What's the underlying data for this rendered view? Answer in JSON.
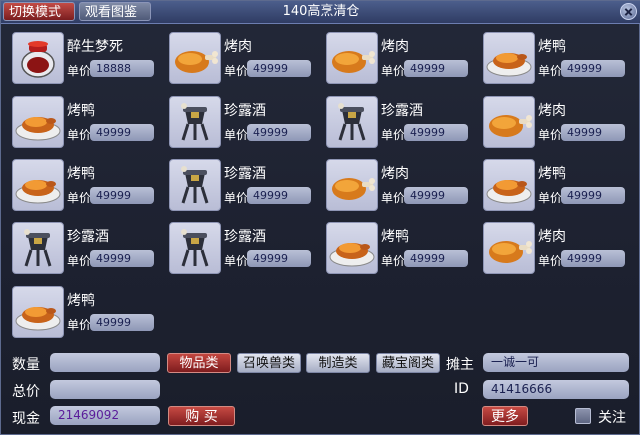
{
  "titlebar": {
    "switch_mode_label": "切换模式",
    "view_catalog_label": "观看图鉴",
    "title": "140高烹清仓"
  },
  "items": [
    {
      "name": "醉生梦死",
      "price_label": "单价",
      "price": "18888",
      "icon": "wine-jar-icon"
    },
    {
      "name": "烤肉",
      "price_label": "单价",
      "price": "49999",
      "icon": "roast-meat-icon"
    },
    {
      "name": "烤肉",
      "price_label": "单价",
      "price": "49999",
      "icon": "roast-meat-icon"
    },
    {
      "name": "烤鸭",
      "price_label": "单价",
      "price": "49999",
      "icon": "roast-duck-icon"
    },
    {
      "name": "烤鸭",
      "price_label": "单价",
      "price": "49999",
      "icon": "roast-duck-icon"
    },
    {
      "name": "珍露酒",
      "price_label": "单价",
      "price": "49999",
      "icon": "wine-cup-icon"
    },
    {
      "name": "珍露酒",
      "price_label": "单价",
      "price": "49999",
      "icon": "wine-cup-icon"
    },
    {
      "name": "烤肉",
      "price_label": "单价",
      "price": "49999",
      "icon": "roast-meat-icon"
    },
    {
      "name": "烤鸭",
      "price_label": "单价",
      "price": "49999",
      "icon": "roast-duck-icon"
    },
    {
      "name": "珍露酒",
      "price_label": "单价",
      "price": "49999",
      "icon": "wine-cup-icon"
    },
    {
      "name": "烤肉",
      "price_label": "单价",
      "price": "49999",
      "icon": "roast-meat-icon"
    },
    {
      "name": "烤鸭",
      "price_label": "单价",
      "price": "49999",
      "icon": "roast-duck-icon"
    },
    {
      "name": "珍露酒",
      "price_label": "单价",
      "price": "49999",
      "icon": "wine-cup-icon"
    },
    {
      "name": "珍露酒",
      "price_label": "单价",
      "price": "49999",
      "icon": "wine-cup-icon"
    },
    {
      "name": "烤鸭",
      "price_label": "单价",
      "price": "49999",
      "icon": "roast-duck-icon"
    },
    {
      "name": "烤肉",
      "price_label": "单价",
      "price": "49999",
      "icon": "roast-meat-icon"
    },
    {
      "name": "烤鸭",
      "price_label": "单价",
      "price": "49999",
      "icon": "roast-duck-icon"
    }
  ],
  "bottom": {
    "quantity_label": "数量",
    "quantity_value": "",
    "total_label": "总价",
    "total_value": "",
    "cash_label": "现金",
    "cash_value": "21469092",
    "buy_label": "购 买",
    "categories": [
      "物品类",
      "召唤兽类",
      "制造类",
      "藏宝阁类"
    ],
    "owner_label": "摊主",
    "owner_value": "一诚一可",
    "id_label": "ID",
    "id_value": "41416666",
    "more_label": "更多",
    "follow_label": "关注"
  },
  "colors": {
    "accent_red": "#a8302c",
    "price_text": "#1a2050",
    "cash_text": "#5a1c9a"
  }
}
